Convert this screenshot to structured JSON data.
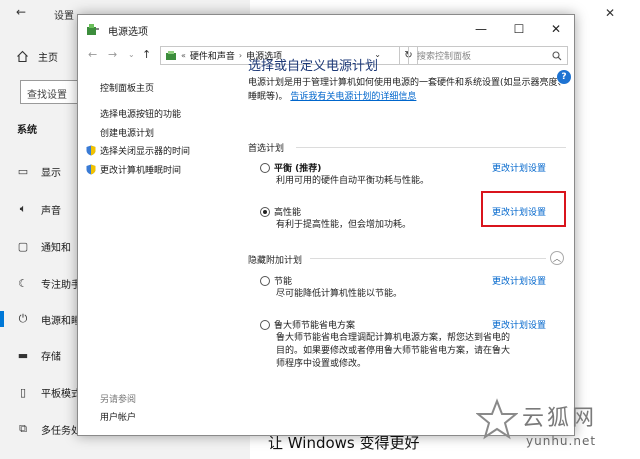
{
  "settings": {
    "title": "设置",
    "home_label": "主页",
    "search_placeholder": "查找设置",
    "section_label": "系统",
    "nav_items": [
      {
        "label": "显示",
        "icon": "monitor-icon"
      },
      {
        "label": "声音",
        "icon": "speaker-icon"
      },
      {
        "label": "通知和",
        "icon": "notification-icon"
      },
      {
        "label": "专注助手",
        "icon": "moon-icon"
      },
      {
        "label": "电源和睡",
        "icon": "power-icon"
      },
      {
        "label": "存储",
        "icon": "storage-icon"
      },
      {
        "label": "平板模式",
        "icon": "tablet-icon"
      },
      {
        "label": "多任务处",
        "icon": "multitask-icon"
      }
    ],
    "main_footer_text": "让 Windows 变得更好"
  },
  "control_panel": {
    "title": "电源选项",
    "window_buttons": {
      "minimize": "—",
      "maximize": "☐",
      "close": "✕"
    },
    "breadcrumb": [
      "硬件和声音",
      "电源选项"
    ],
    "search_placeholder": "搜索控制面板",
    "left_pane": {
      "home_link": "控制面板主页",
      "links": [
        "选择电源按钮的功能",
        "创建电源计划",
        "选择关闭显示器的时间",
        "更改计算机睡眠时间"
      ],
      "see_also": "另请参阅",
      "user_accounts": "用户帐户"
    },
    "main": {
      "heading": "选择或自定义电源计划",
      "description": "电源计划是用于管理计算机如何使用电源的一套硬件和系统设置(如显示器亮度、睡眠等)。",
      "description_link": "告诉我有关电源计划的详细信息",
      "preferred_label": "首选计划",
      "hidden_label": "隐藏附加计划",
      "change_link_label": "更改计划设置",
      "plans": [
        {
          "name": "平衡 (推荐)",
          "description": "利用可用的硬件自动平衡功耗与性能。",
          "selected": false
        },
        {
          "name": "高性能",
          "description": "有利于提高性能，但会增加功耗。",
          "selected": true
        },
        {
          "name": "节能",
          "description": "尽可能降低计算机性能以节能。",
          "selected": false
        },
        {
          "name": "鲁大师节能省电方案",
          "description": "鲁大师节能省电合理调配计算机电源方案，帮您达到省电的目的。如果要修改或者停用鲁大师节能省电方案，请在鲁大师程序中设置或修改。",
          "selected": false
        }
      ]
    }
  },
  "watermark": {
    "text": "云狐网",
    "url": "yunhu.net"
  },
  "colors": {
    "accent": "#0078d7",
    "link": "#0066cc",
    "heading": "#1e3a78",
    "highlight": "#d9141c"
  }
}
